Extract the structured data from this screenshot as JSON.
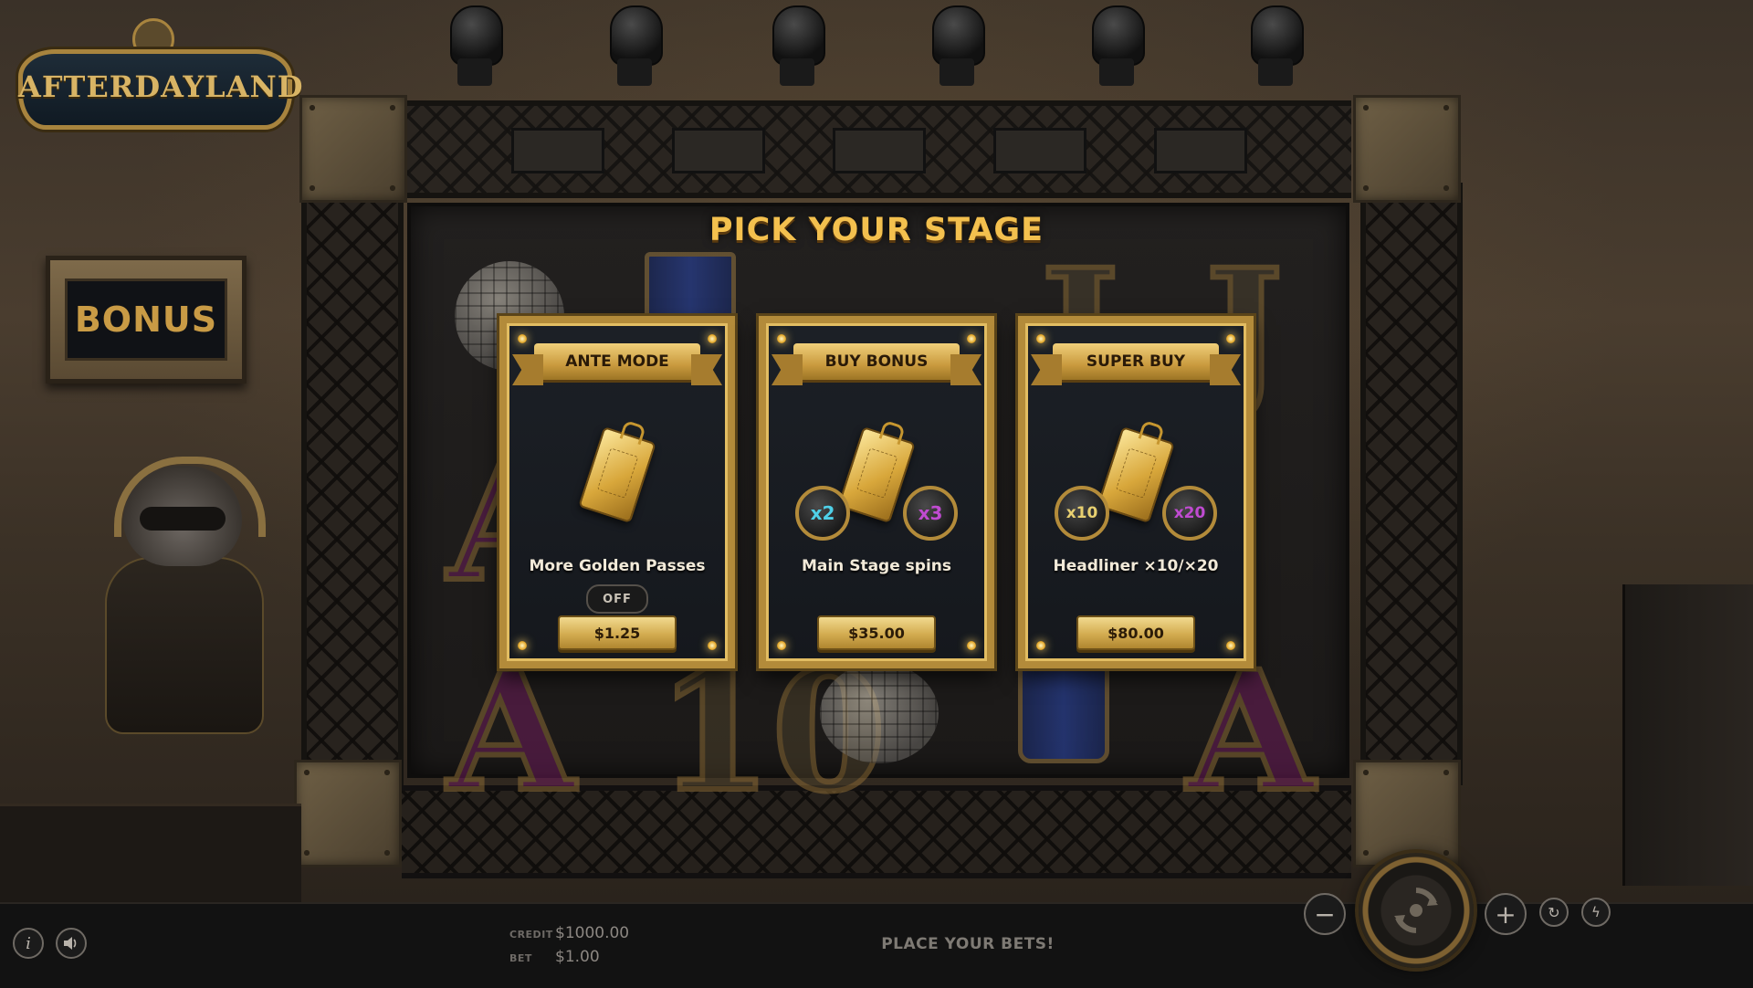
{
  "game": {
    "logo_text": "AFTERDAYLAND",
    "bonus_label": "BONUS"
  },
  "stage_select": {
    "title": "PICK YOUR STAGE",
    "cards": [
      {
        "header": "ANTE MODE",
        "description": "More Golden Passes",
        "toggle": "OFF",
        "price": "$1.25",
        "multipliers": []
      },
      {
        "header": "BUY BONUS",
        "description": "Main Stage spins",
        "price": "$35.00",
        "multipliers": [
          "x2",
          "x3"
        ]
      },
      {
        "header": "SUPER BUY",
        "description": "Headliner ×10/×20",
        "price": "$80.00",
        "multipliers": [
          "x10",
          "x20"
        ]
      }
    ]
  },
  "bottom_bar": {
    "credit_label": "CREDIT",
    "credit_value": "$1000.00",
    "bet_label": "BET",
    "bet_value": "$1.00",
    "message": "PLACE YOUR BETS!",
    "info_icon": "info-icon",
    "sound_icon": "speaker-icon",
    "minus_icon": "minus-icon",
    "plus_icon": "plus-icon",
    "autoplay_icon": "refresh-icon",
    "turbo_icon": "lightning-icon",
    "spin_icon": "spin-arrows-icon"
  },
  "colors": {
    "gold": "#f3c04e",
    "card_border": "#b38b3a",
    "multiplier_blue": "#4fd0e8",
    "multiplier_purple": "#c04bd1"
  }
}
